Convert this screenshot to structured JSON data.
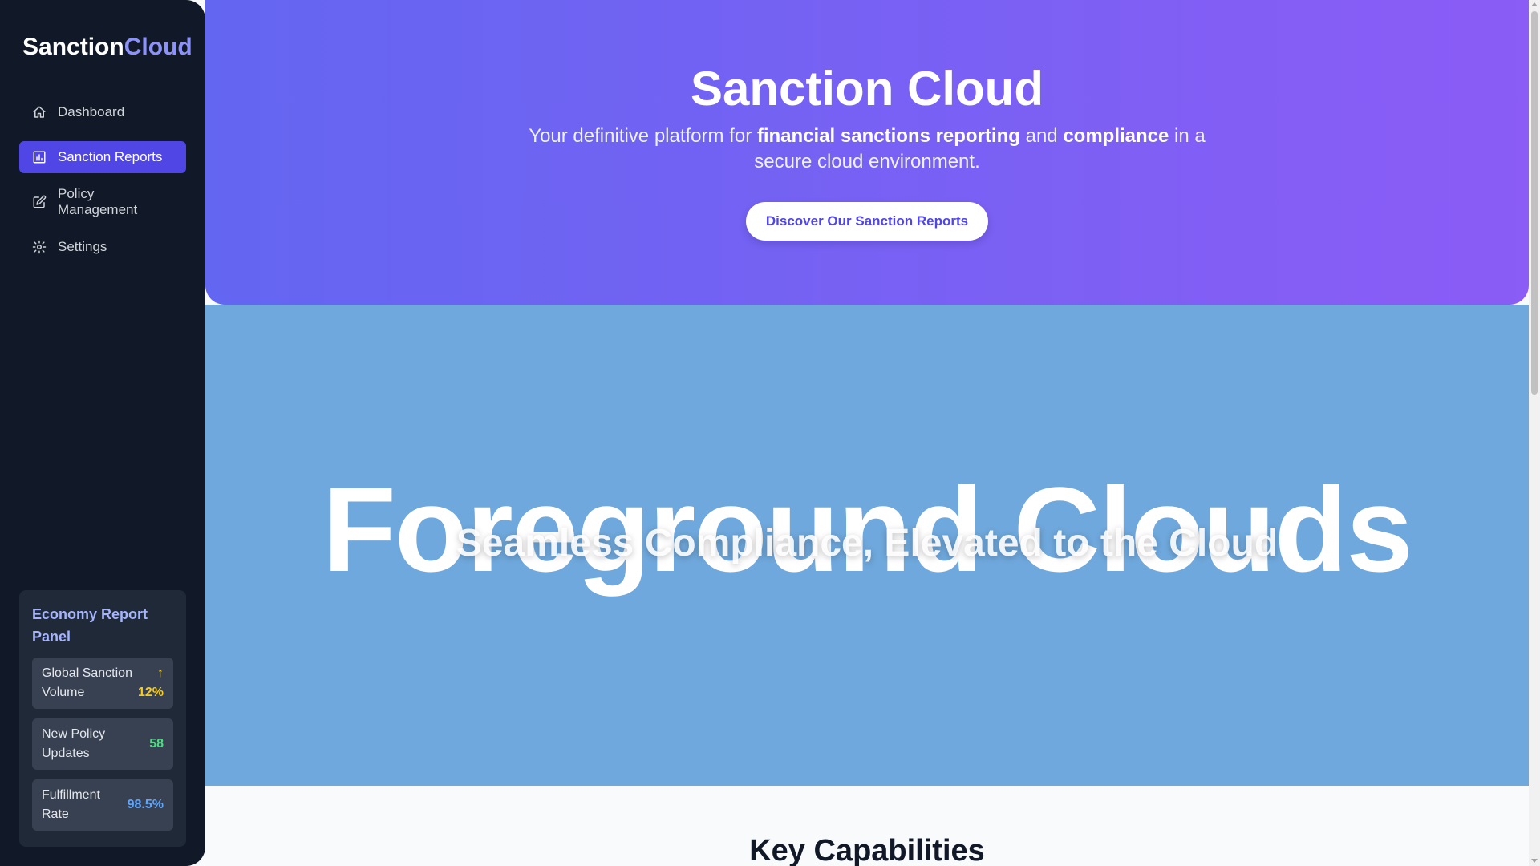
{
  "sidebar": {
    "logo_main": "Sanction",
    "logo_accent": "Cloud",
    "items": [
      {
        "label": "Dashboard",
        "icon": "home-icon"
      },
      {
        "label": "Sanction Reports",
        "icon": "chart-icon",
        "active": true
      },
      {
        "label": "Policy Management",
        "icon": "edit-icon"
      },
      {
        "label": "Settings",
        "icon": "gear-icon"
      }
    ],
    "economy_panel": {
      "title": "Economy Report Panel",
      "stats": [
        {
          "label": "Global Sanction Volume",
          "trend": "↑",
          "value": "12%",
          "color": "#facc15"
        },
        {
          "label": "New Policy Updates",
          "value": "58",
          "color": "#4ade80"
        },
        {
          "label": "Fulfillment Rate",
          "value": "98.5%",
          "color": "#60a5fa"
        }
      ]
    }
  },
  "hero": {
    "title": "Sanction Cloud",
    "subtitle_1": "Your definitive platform for ",
    "subtitle_bold_1": "financial sanctions reporting",
    "subtitle_2": " and ",
    "subtitle_bold_2": "compliance",
    "subtitle_3": " in a secure cloud environment.",
    "cta_label": "Discover Our Sanction Reports"
  },
  "cloud_band": {
    "overlay_text": "Foreground Clouds",
    "heading": "Seamless Compliance, Elevated to the Cloud"
  },
  "section": {
    "title": "Key Capabilities"
  },
  "colors": {
    "sidebar_bg": "#111827",
    "accent": "#4f46e5",
    "hero_gradient_start": "#6366f1",
    "hero_gradient_end": "#8b5cf6",
    "cloud_band_bg": "#6fa8dc"
  }
}
